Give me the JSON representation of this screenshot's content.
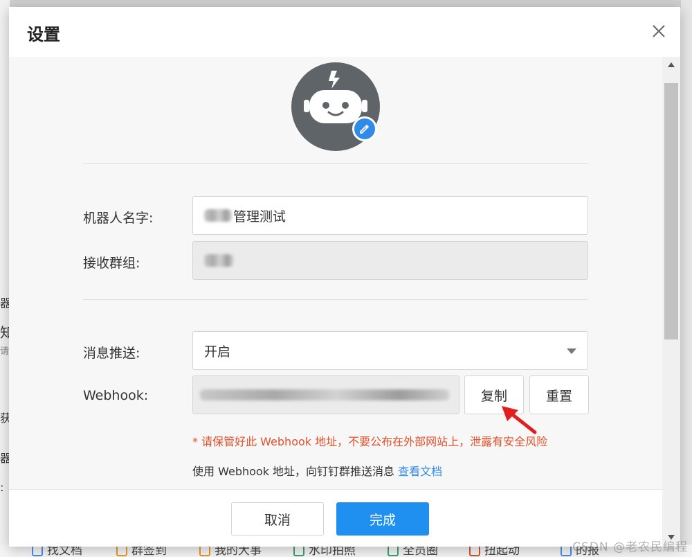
{
  "dialog": {
    "title": "设置",
    "close_icon": "close-icon"
  },
  "form": {
    "robot_name_label": "机器人名字:",
    "robot_name_value": "管理测试",
    "group_label": "接收群组:",
    "push_label": "消息推送:",
    "push_value": "开启",
    "webhook_label": "Webhook:",
    "copy_label": "复制",
    "reset_label": "重置",
    "warning": "* 请保管好此 Webhook 地址，不要公布在外部网站上，泄露有安全风险",
    "hint_text": "使用 Webhook 地址，向钉钉群推送消息",
    "hint_link": "查看文档"
  },
  "footer": {
    "cancel_label": "取消",
    "done_label": "完成"
  },
  "background": {
    "left_items": [
      "器",
      "知",
      "请",
      "获",
      "器",
      ":"
    ],
    "bottom_items": [
      "找文档",
      "群签到",
      "我的大事",
      "水印拍照",
      "全员圈",
      "扭起动",
      "的报"
    ],
    "watermark": "CSDN @老农民编程"
  },
  "colors": {
    "primary": "#1f8ff0",
    "warning": "#e1502b",
    "link": "#2f8ae8",
    "avatar_bg": "#5f6469"
  }
}
